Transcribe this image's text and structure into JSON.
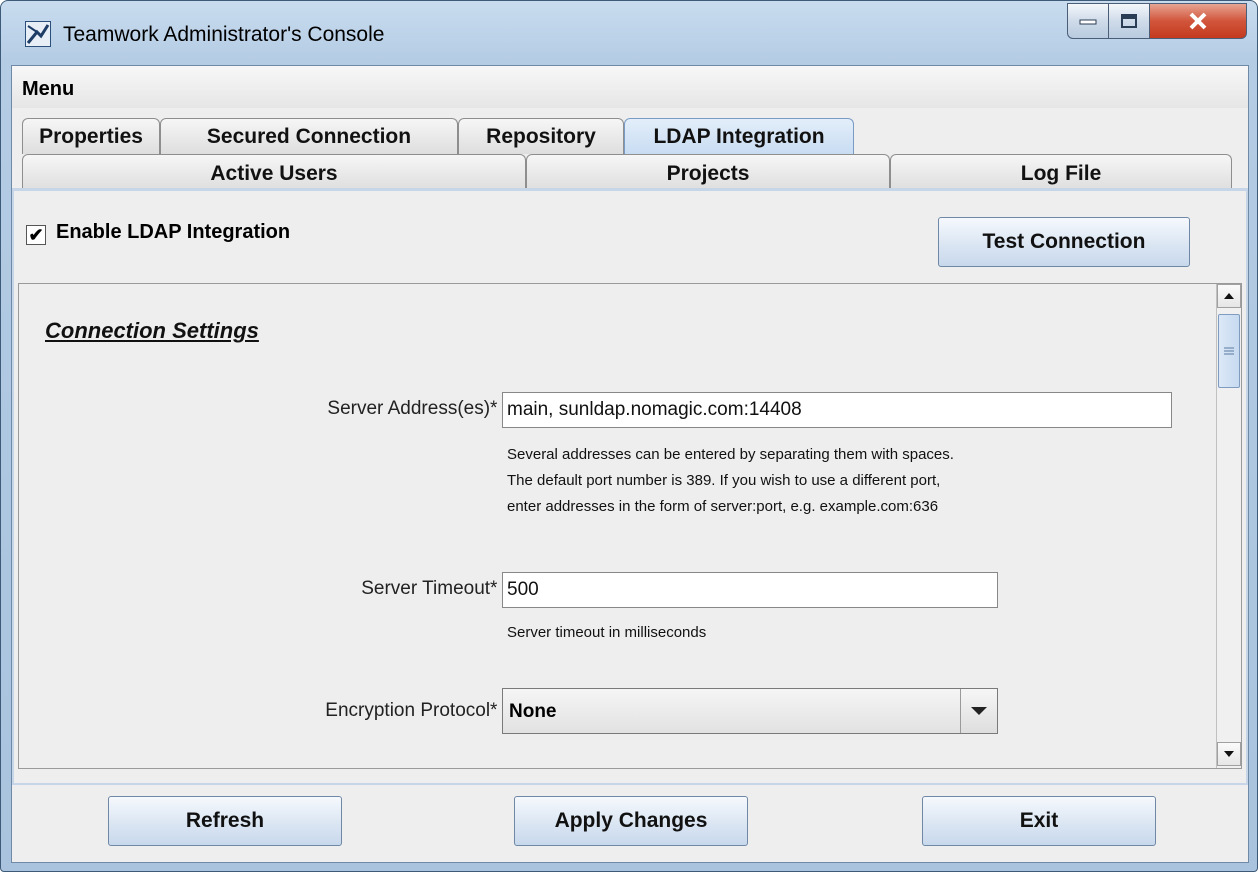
{
  "window": {
    "title": "Teamwork Administrator's Console",
    "controls": {
      "minimize": "minimize-icon",
      "maximize": "maximize-icon",
      "close": "close-icon"
    }
  },
  "menu": {
    "label": "Menu"
  },
  "tabs": {
    "row1": [
      "Properties",
      "Secured Connection",
      "Repository",
      "LDAP Integration"
    ],
    "row2": [
      "Active Users",
      "Projects",
      "Log File"
    ],
    "active": "LDAP Integration"
  },
  "ldap": {
    "enable_label": "Enable LDAP Integration",
    "enabled": true,
    "test_button": "Test Connection"
  },
  "connection": {
    "section_title": "Connection Settings",
    "server_address": {
      "label": "Server Address(es)* :",
      "value": "main, sunldap.nomagic.com:14408",
      "hint": [
        "Several addresses can be entered by separating them with spaces.",
        "The default port number is 389. If you wish to use a different port,",
        "enter addresses in the form of server:port, e.g. example.com:636"
      ]
    },
    "server_timeout": {
      "label": "Server Timeout* :",
      "value": "500",
      "hint": "Server timeout in milliseconds"
    },
    "encryption_protocol": {
      "label": "Encryption Protocol* :",
      "value": "None"
    }
  },
  "footer": {
    "refresh": "Refresh",
    "apply": "Apply Changes",
    "exit": "Exit"
  }
}
